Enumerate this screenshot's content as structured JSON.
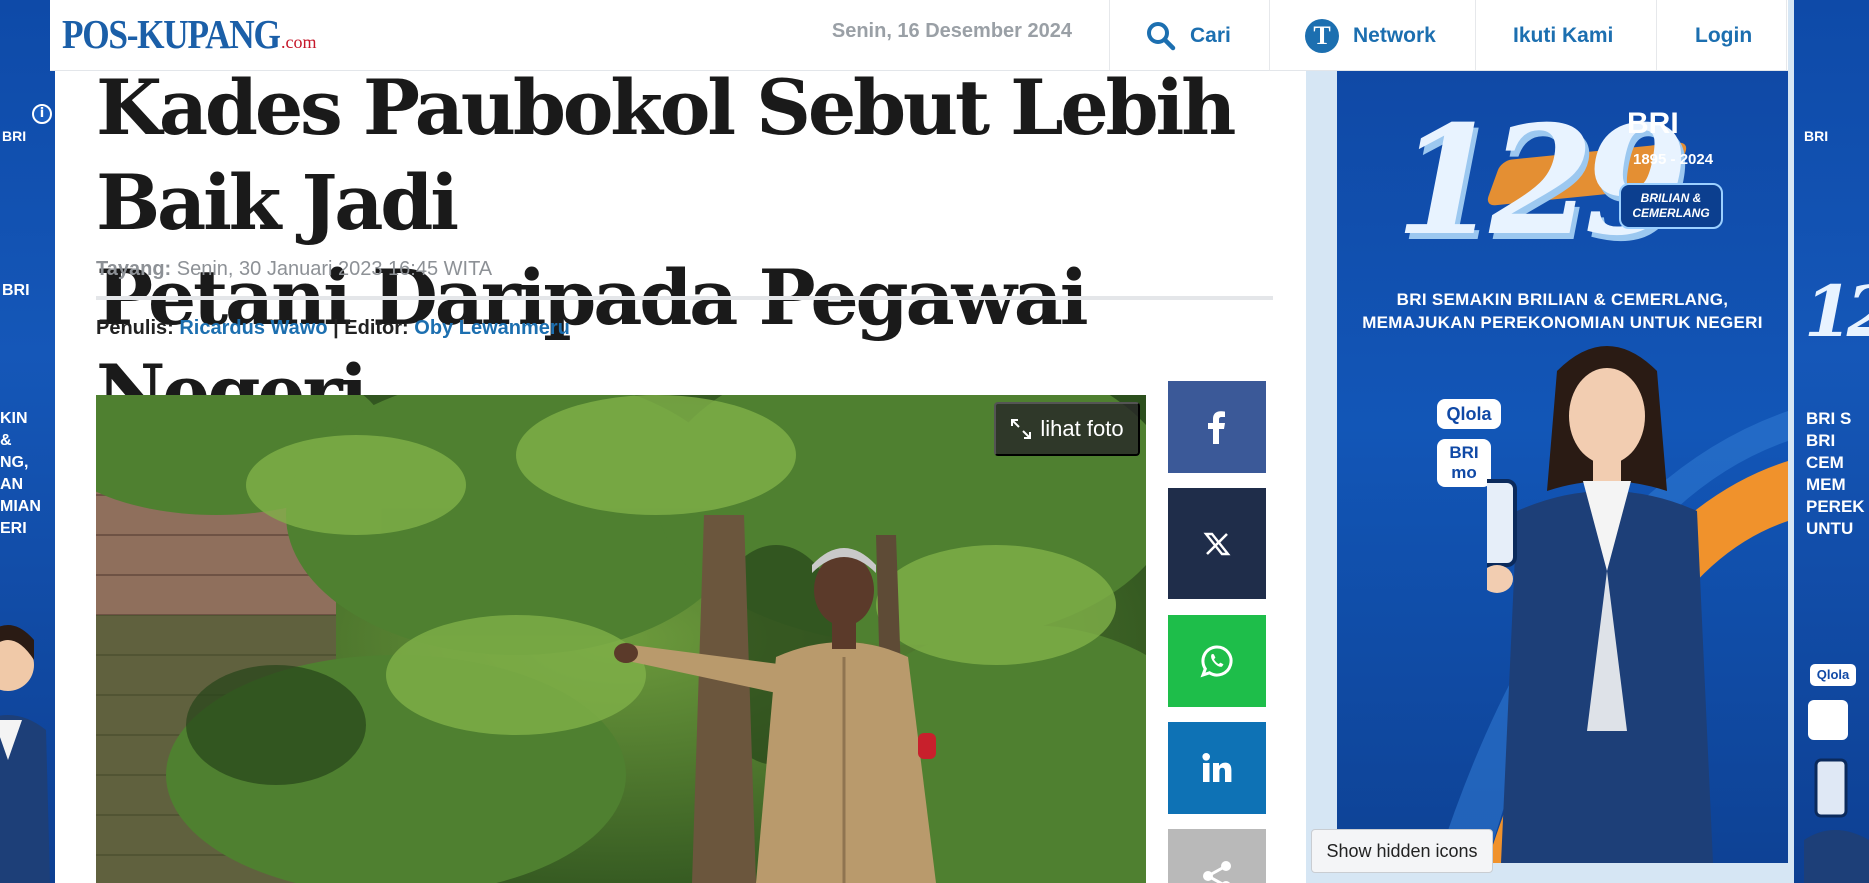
{
  "header": {
    "logo_main": "POS-KUPANG",
    "logo_suffix": ".com",
    "date": "Senin, 16 Desember 2024",
    "nav": {
      "search_label": "Cari",
      "network_icon_letter": "T",
      "network_label": "Network",
      "follow_label": "Ikuti Kami",
      "login_label": "Login"
    }
  },
  "article": {
    "headline_line1": "Kades Paubokol Sebut Lebih Baik Jadi",
    "headline_line2": "Petani Daripada Pegawai Negeri",
    "published_label": "Tayang:",
    "published_value": "Senin, 30 Januari 2023 16:45 WITA",
    "author_label": "Penulis:",
    "author_name": "Ricardus Wawo",
    "separator": "|",
    "editor_label": "Editor:",
    "editor_name": "Oby Lewanmeru",
    "photo_button": "lihat foto"
  },
  "share": {
    "items": [
      {
        "icon": "facebook-icon",
        "color": "#3b5998"
      },
      {
        "icon": "x-icon",
        "color": "#1f2d4a"
      },
      {
        "icon": "whatsapp-icon",
        "color": "#1ebe4a"
      },
      {
        "icon": "linkedin-icon",
        "color": "#0e72b5"
      },
      {
        "icon": "share-icon",
        "color": "#b9b9b9"
      }
    ]
  },
  "ad": {
    "anniversary": "129",
    "brand": "BRI",
    "years": "1895 - 2024",
    "badge": "BRILIAN & CEMERLANG",
    "tagline_1": "BRI SEMAKIN BRILIAN & CEMERLANG,",
    "tagline_2": "MEMAJUKAN PEREKONOMIAN UNTUK NEGERI",
    "app_1": "Qlola",
    "app_2": "BRI mo",
    "left_skin_text": "KIN & NG, AN MIAN ERI",
    "right_skin_text": "BRI S BRI CEM MEM PEREK UNTU"
  },
  "tooltip": {
    "label": "Show hidden icons"
  },
  "colors": {
    "brand_blue": "#1c6fb0",
    "logo_red": "#c6172a",
    "ad_blue": "#1049a6"
  }
}
